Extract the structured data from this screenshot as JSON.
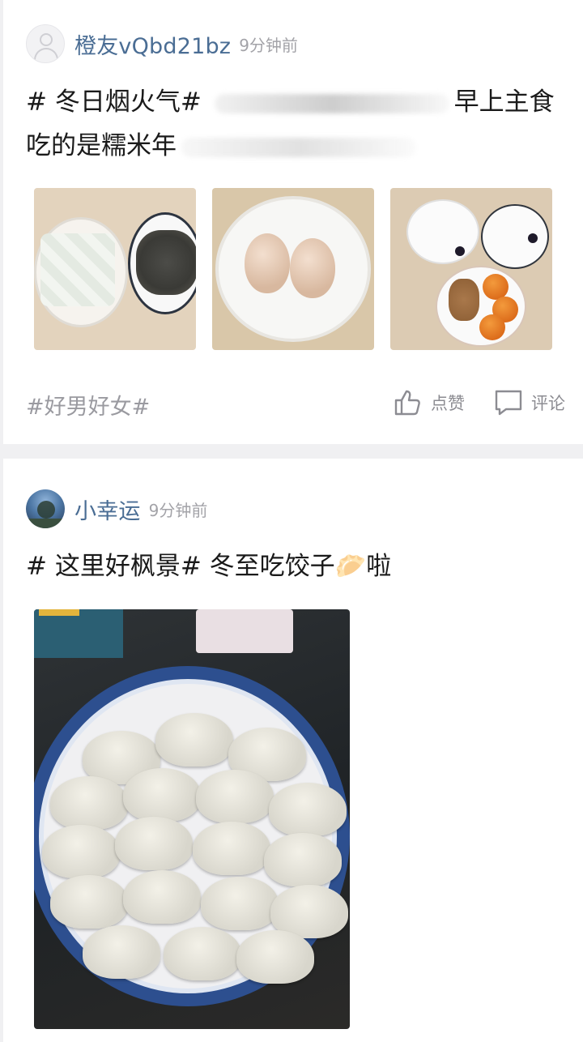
{
  "posts": [
    {
      "username": "橙友vQbd21bz",
      "time": "9分钟前",
      "text_main": "# 冬日烟火气# ",
      "text_after_blur": "早上主食吃的是糯米年",
      "tag": "#好男好女#",
      "actions": {
        "like_label": "点赞",
        "comment_label": "评论"
      }
    },
    {
      "username": "小幸运",
      "time": "9分钟前",
      "text_main": "# 这里好枫景# 冬至吃饺子",
      "dumpling_emoji": "🥟",
      "text_end": "啦"
    }
  ],
  "colors": {
    "username": "#4a6d94",
    "meta": "#a3a3a8",
    "text": "#1a1a1a",
    "plate_blue": "#2d4f8f"
  }
}
